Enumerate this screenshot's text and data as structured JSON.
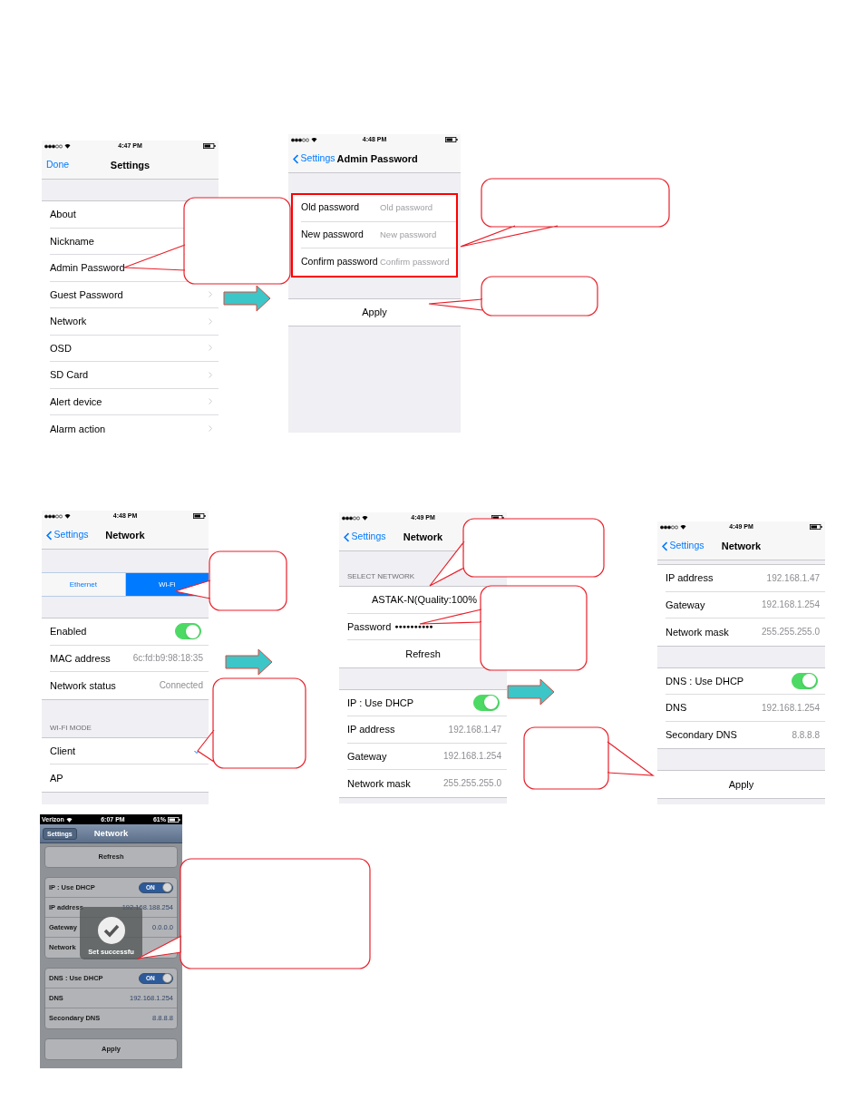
{
  "screens": [
    {
      "kind": "flat",
      "status": {
        "time": "4:47 PM"
      },
      "nav": {
        "left": "Done",
        "back": false,
        "title": "Settings"
      },
      "sections": [
        {
          "rows": [
            {
              "kind": "nav",
              "label": "About",
              "chevron": false
            },
            {
              "kind": "nav",
              "label": "Nickname",
              "chevron": false
            },
            {
              "kind": "nav",
              "label": "Admin Password",
              "chevron": false
            },
            {
              "kind": "nav",
              "label": "Guest Password",
              "chevron": true
            },
            {
              "kind": "nav",
              "label": "Network",
              "chevron": true
            },
            {
              "kind": "nav",
              "label": "OSD",
              "chevron": true
            },
            {
              "kind": "nav",
              "label": "SD Card",
              "chevron": true
            },
            {
              "kind": "nav",
              "label": "Alert device",
              "chevron": true
            },
            {
              "kind": "nav",
              "label": "Alarm action",
              "chevron": true
            }
          ]
        }
      ]
    },
    {
      "kind": "flat",
      "status": {
        "time": "4:48 PM"
      },
      "nav": {
        "left": "Settings",
        "back": true,
        "title": "Admin Password"
      },
      "sections": [
        {
          "highlighted": true,
          "rows": [
            {
              "kind": "field",
              "label": "Old password",
              "placeholder": "Old password"
            },
            {
              "kind": "field",
              "label": "New password",
              "placeholder": "New password"
            },
            {
              "kind": "field",
              "label": "Confirm password",
              "placeholder": "Confirm password"
            }
          ]
        },
        {
          "rows": [
            {
              "kind": "button",
              "label": "Apply"
            }
          ]
        }
      ]
    },
    {
      "kind": "flat",
      "status": {
        "time": "4:48 PM"
      },
      "nav": {
        "left": "Settings",
        "back": true,
        "title": "Network"
      },
      "sections": [
        {
          "rows": [
            {
              "kind": "segmented",
              "options": [
                {
                  "label": "Ethernet",
                  "selected": false
                },
                {
                  "label": "Wi-Fi",
                  "selected": true
                }
              ]
            }
          ]
        },
        {
          "rows": [
            {
              "kind": "toggle",
              "label": "Enabled",
              "on": true
            },
            {
              "kind": "value",
              "label": "MAC address",
              "value": "6c:fd:b9:98:18:35"
            },
            {
              "kind": "value",
              "label": "Network status",
              "value": "Connected"
            }
          ]
        },
        {
          "header": "WI-FI MODE",
          "rows": [
            {
              "kind": "check",
              "label": "Client",
              "checked": true
            },
            {
              "kind": "check",
              "label": "AP",
              "checked": false
            }
          ]
        }
      ]
    },
    {
      "kind": "flat",
      "status": {
        "time": "4:49 PM"
      },
      "nav": {
        "left": "Settings",
        "back": true,
        "title": "Network"
      },
      "sections": [
        {
          "header": "SELECT NETWORK",
          "rows": [
            {
              "kind": "center",
              "label": "ASTAK-N(Quality:100%"
            },
            {
              "kind": "password",
              "label": "Password",
              "value": "●●●●●●●●●●"
            },
            {
              "kind": "button",
              "label": "Refresh"
            }
          ]
        },
        {
          "rows": [
            {
              "kind": "toggle",
              "label": "IP : Use DHCP",
              "on": true
            },
            {
              "kind": "value",
              "label": "IP address",
              "value": "192.168.1.47"
            },
            {
              "kind": "value",
              "label": "Gateway",
              "value": "192.168.1.254"
            },
            {
              "kind": "value",
              "label": "Network mask",
              "value": "255.255.255.0"
            }
          ]
        }
      ]
    },
    {
      "kind": "flat",
      "status": {
        "time": "4:49 PM"
      },
      "nav": {
        "left": "Settings",
        "back": true,
        "title": "Network"
      },
      "sections": [
        {
          "rows": [
            {
              "kind": "value",
              "label": "IP address",
              "value": "192.168.1.47"
            },
            {
              "kind": "value",
              "label": "Gateway",
              "value": "192.168.1.254"
            },
            {
              "kind": "value",
              "label": "Network mask",
              "value": "255.255.255.0"
            }
          ]
        },
        {
          "rows": [
            {
              "kind": "toggle",
              "label": "DNS : Use DHCP",
              "on": true
            },
            {
              "kind": "value",
              "label": "DNS",
              "value": "192.168.1.254"
            },
            {
              "kind": "value",
              "label": "Secondary DNS",
              "value": "8.8.8.8"
            }
          ]
        },
        {
          "rows": [
            {
              "kind": "button",
              "label": "Apply"
            }
          ]
        }
      ]
    },
    {
      "kind": "classic",
      "status": {
        "carrier": "Verizon",
        "time": "6:07 PM",
        "battery": "61%"
      },
      "nav": {
        "left": "Settings",
        "title": "Network"
      },
      "sections": [
        {
          "rows": [
            {
              "kind": "button",
              "label": "Refresh"
            }
          ]
        },
        {
          "rows": [
            {
              "kind": "toggle",
              "label": "IP : Use DHCP",
              "on": true,
              "text": "ON"
            },
            {
              "kind": "value",
              "label": "IP address",
              "value": "192.168.188.254"
            },
            {
              "kind": "value",
              "label": "Gateway",
              "value": "0.0.0.0"
            },
            {
              "kind": "value",
              "label": "Network"
            }
          ]
        },
        {
          "rows": [
            {
              "kind": "toggle",
              "label": "DNS : Use DHCP",
              "on": true,
              "text": "ON"
            },
            {
              "kind": "value",
              "label": "DNS",
              "value": "192.168.1.254"
            },
            {
              "kind": "value",
              "label": "Secondary DNS",
              "value": "8.8.8.8"
            }
          ]
        },
        {
          "rows": [
            {
              "kind": "button",
              "label": "Apply"
            }
          ]
        }
      ],
      "overlay": {
        "message": "Set successfu"
      }
    }
  ]
}
